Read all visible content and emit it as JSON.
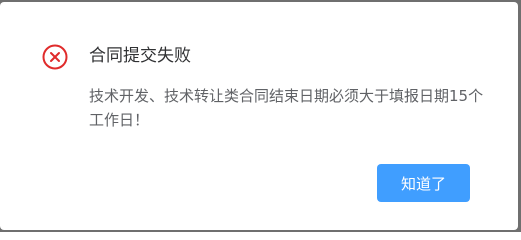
{
  "dialog": {
    "icon": "error-circle-icon",
    "title": "合同提交失败",
    "message": "技术开发、技术转让类合同结束日期必须大于填报日期15个工作日！",
    "ok_label": "知道了"
  },
  "colors": {
    "error": "#e02b2b",
    "primary": "#409eff",
    "title_text": "#303133",
    "message_text": "#606266"
  }
}
